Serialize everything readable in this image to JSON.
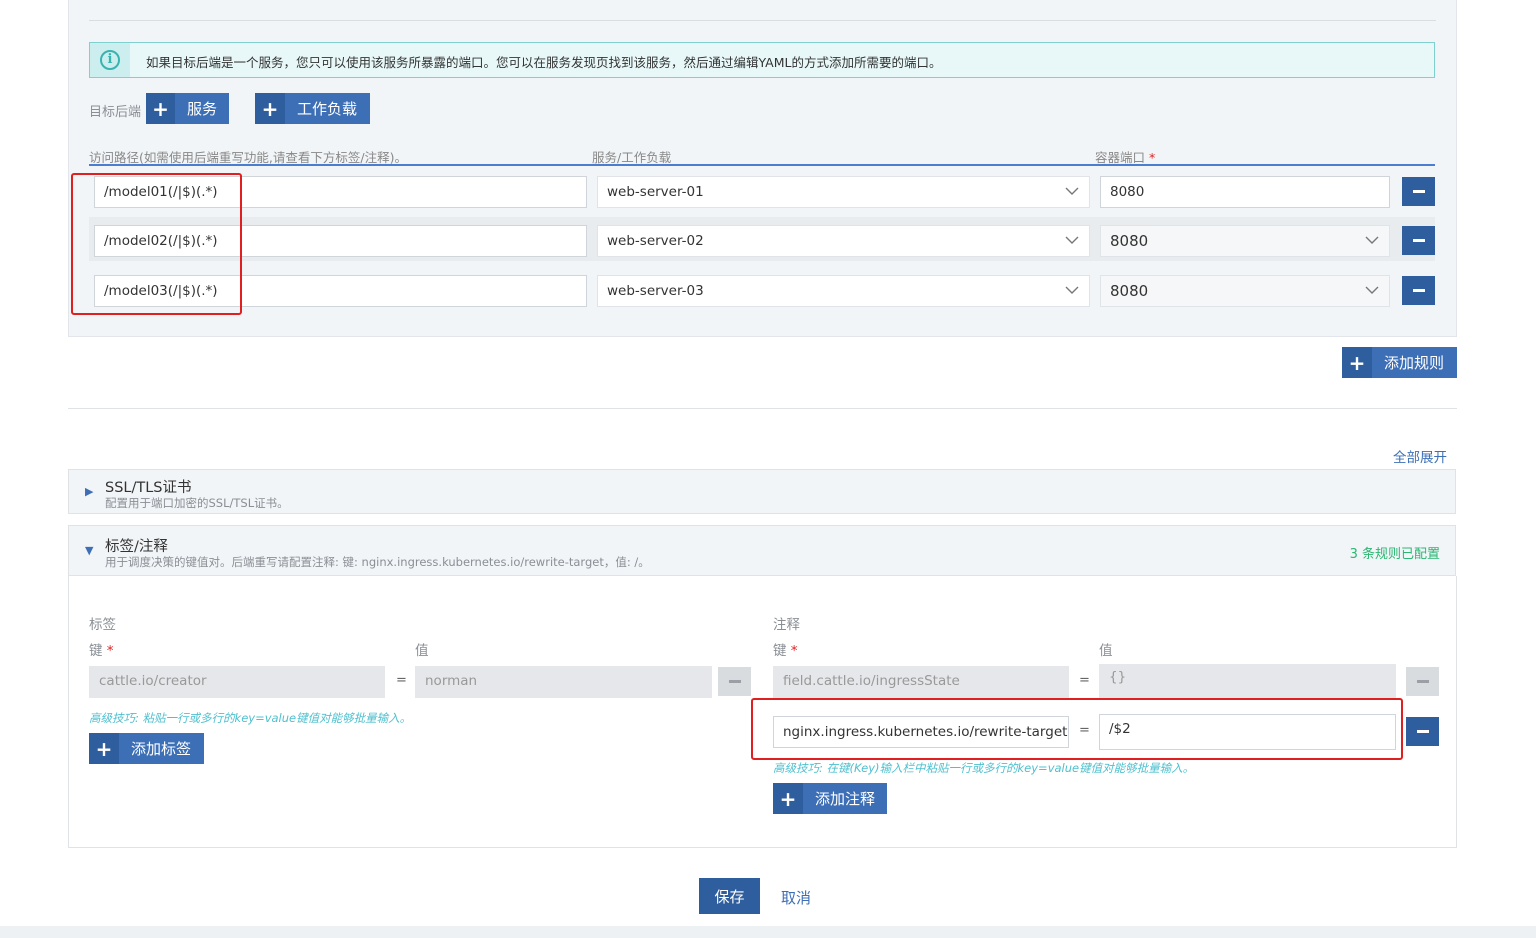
{
  "info": {
    "text": "如果目标后端是一个服务，您只可以使用该服务所暴露的端口。您可以在服务发现页找到该服务，然后通过编辑YAML的方式添加所需要的端口。"
  },
  "target": {
    "label": "目标后端",
    "service_button": "服务",
    "workload_button": "工作负载"
  },
  "columns": {
    "path": "访问路径(如需使用后端重写功能,请查看下方标签/注释)。",
    "backend": "服务/工作负载",
    "port": "容器端口",
    "required": "*"
  },
  "rules": [
    {
      "path": "/model01(/|$)(.*)",
      "backend": "web-server-01",
      "port": "8080"
    },
    {
      "path": "/model02(/|$)(.*)",
      "backend": "web-server-02",
      "port": "8080"
    },
    {
      "path": "/model03(/|$)(.*)",
      "backend": "web-server-03",
      "port": "8080"
    }
  ],
  "add_rule_button": "添加规则",
  "expand_all": "全部展开",
  "ssl": {
    "title": "SSL/TLS证书",
    "subtitle": "配置用于端口加密的SSL/TSL证书。"
  },
  "labels_section": {
    "title": "标签/注释",
    "subtitle": "用于调度决策的键值对。后端重写请配置注释: 键: nginx.ingress.kubernetes.io/rewrite-target，值: /。",
    "status": "3 条规则已配置"
  },
  "labels": {
    "heading": "标签",
    "key_label": "键",
    "value_label": "值",
    "key": "cattle.io/creator",
    "value": "norman",
    "tip": "高级技巧: 粘贴一行或多行的key=value键值对能够批量输入。",
    "add_button": "添加标签"
  },
  "annotations": {
    "heading": "注释",
    "key_label": "键",
    "value_label": "值",
    "items": [
      {
        "key": "field.cattle.io/ingressState",
        "value": "{}"
      },
      {
        "key": "nginx.ingress.kubernetes.io/rewrite-target",
        "value": "/$2"
      }
    ],
    "tip": "高级技巧: 在键(Key)输入栏中粘贴一行或多行的key=value键值对能够批量输入。",
    "add_button": "添加注释"
  },
  "eq": "=",
  "footer": {
    "save": "保存",
    "cancel": "取消"
  },
  "colors": {
    "accent": "#3d6fb6",
    "highlight": "#e02020",
    "success": "#2bb673"
  }
}
